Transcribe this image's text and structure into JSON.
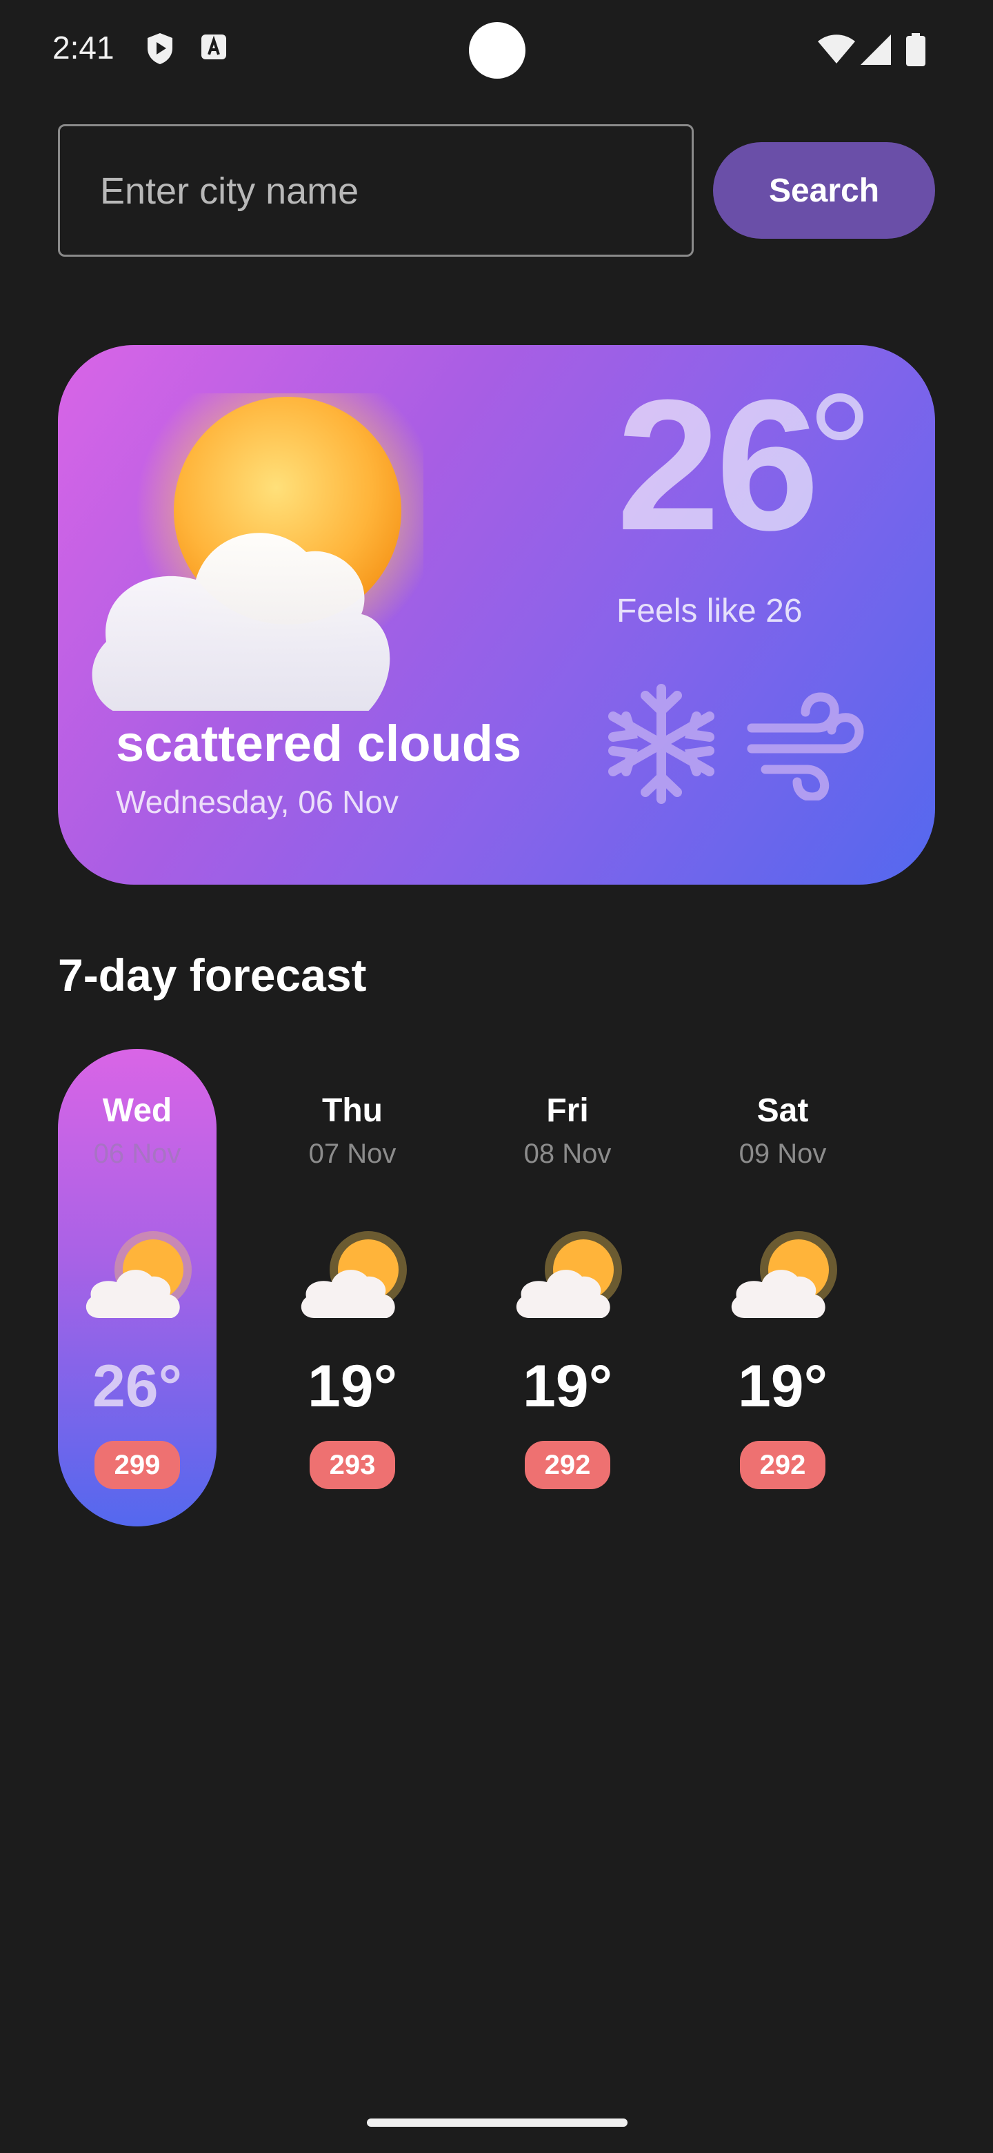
{
  "status_bar": {
    "time": "2:41",
    "icons": [
      "shield-play-icon",
      "a11y-text-icon",
      "wifi-icon",
      "cellular-icon",
      "battery-icon"
    ]
  },
  "search": {
    "placeholder": "Enter city name",
    "button_label": "Search"
  },
  "current": {
    "temperature": "26",
    "feels_like": "Feels like 26",
    "description": "scattered clouds",
    "date": "Wednesday, 06 Nov",
    "icon": "partly-cloudy-icon",
    "extra_icons": [
      "snowflake-icon",
      "wind-icon"
    ]
  },
  "forecast": {
    "title": "7-day forecast",
    "days": [
      {
        "day": "Wed",
        "date": "06 Nov",
        "temp": "26°",
        "badge": "299",
        "active": true
      },
      {
        "day": "Thu",
        "date": "07 Nov",
        "temp": "19°",
        "badge": "293",
        "active": false
      },
      {
        "day": "Fri",
        "date": "08 Nov",
        "temp": "19°",
        "badge": "292",
        "active": false
      },
      {
        "day": "Sat",
        "date": "09 Nov",
        "temp": "19°",
        "badge": "292",
        "active": false
      }
    ]
  },
  "colors": {
    "background": "#1c1c1c",
    "accent": "#6a4fa8",
    "card_gradient_start": "#d965e6",
    "card_gradient_end": "#5468ee",
    "badge": "#ee7171"
  }
}
